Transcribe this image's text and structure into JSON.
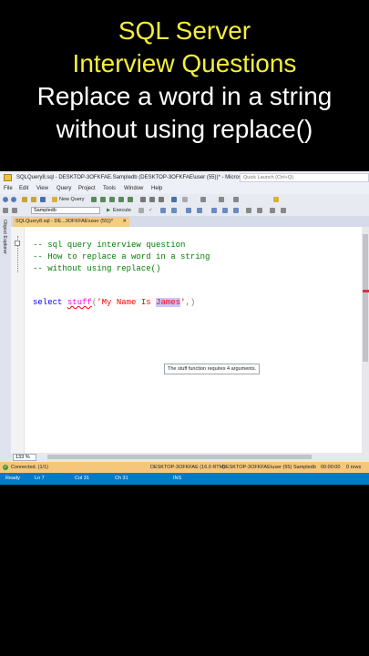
{
  "overlay": {
    "line1": "SQL Server",
    "line2": "Interview  Questions",
    "line3": "Replace a word in a string",
    "line4": "without using replace()"
  },
  "window": {
    "title": "SQLQuery8.sql - DESKTOP-3OFKFAE.Sampledb (DESKTOP-3OFKFAE\\user (55))* - Microsoft SQL...",
    "quick_launch_placeholder": "Quick Launch (Ctrl+Q)"
  },
  "menu": [
    "File",
    "Edit",
    "View",
    "Query",
    "Project",
    "Tools",
    "Window",
    "Help"
  ],
  "toolbar": {
    "new_query": "New Query",
    "database": "Sampledb",
    "execute": "Execute"
  },
  "sidebar": {
    "label": "Object Explorer"
  },
  "tab": {
    "label": "SQLQuery8.sql - DE...3OFKFAE\\user (55))*",
    "close": "✕"
  },
  "code": {
    "comment1": "-- sql query interview question",
    "comment2": "-- How to replace a word in a string",
    "comment3": "-- without using replace()",
    "kw_select": "select",
    "fn_stuff": "stuff",
    "paren_open": "(",
    "str_part": "'My Name Is ",
    "str_highlight": "James",
    "str_end": "'",
    "tail": ",)"
  },
  "tooltip": "The stuff function requires 4 arguments.",
  "zoom": "133 %",
  "connection": {
    "status": "Connected. (1/1)",
    "server": "DESKTOP-3OFKFAE (16.0 RTM)",
    "user": "DESKTOP-3OFKFAE\\user (55)",
    "database": "Sampledb",
    "time": "00:00:00",
    "rows": "0 rows"
  },
  "status": {
    "ready": "Ready",
    "ln": "Ln 7",
    "col": "Col 31",
    "ch": "Ch 31",
    "ins": "INS"
  },
  "colors": {
    "caption_yellow": "#f5ef3a",
    "status_blue": "#007acc",
    "tab_active": "#f5cc84",
    "connection_bar": "#f5c77a"
  }
}
